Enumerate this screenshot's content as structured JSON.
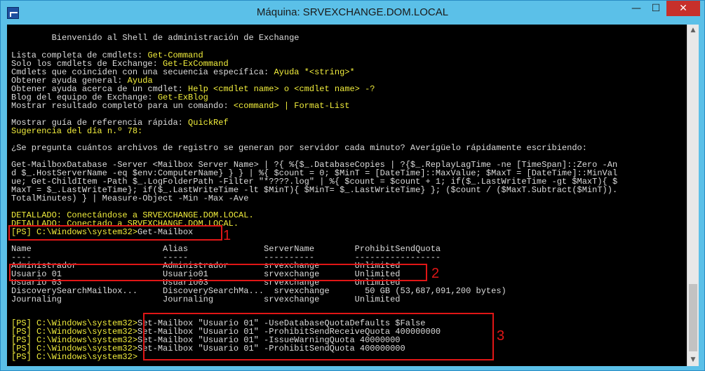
{
  "window": {
    "title": "Máquina: SRVEXCHANGE.DOM.LOCAL",
    "minimize": "—",
    "maximize": "☐",
    "close": "✕"
  },
  "console": {
    "welcome": "Bienvenido al Shell de administración de Exchange",
    "help_lines": [
      {
        "label": "Lista completa de cmdlets: ",
        "cmd": "Get-Command"
      },
      {
        "label": "Solo los cmdlets de Exchange: ",
        "cmd": "Get-ExCommand"
      },
      {
        "label": "Cmdlets que coinciden con una secuencia específica: ",
        "cmd": "Ayuda *<string>*"
      },
      {
        "label": "Obtener ayuda general: ",
        "cmd": "Ayuda"
      },
      {
        "label": "Obtener ayuda acerca de un cmdlet: ",
        "cmd": "Help <cmdlet name> o <cmdlet name> -?"
      },
      {
        "label": "Blog del equipo de Exchange: ",
        "cmd": "Get-ExBlog"
      },
      {
        "label": "Mostrar resultado completo para un comando: ",
        "cmd": "<command> | Format-List"
      }
    ],
    "quickref_label": "Mostrar guía de referencia rápida: ",
    "quickref_cmd": "QuickRef",
    "tip_title": "Sugerencia del día n.º 78:",
    "tip_question": "¿Se pregunta cuántos archivos de registro se generan por servidor cada minuto? Averígüelo rápidamente escribiendo:",
    "tip_code": [
      "Get-MailboxDatabase -Server <Mailbox Server Name> | ?{ %{$_.DatabaseCopies | ?{$_.ReplayLagTime -ne [TimeSpan]::Zero -An",
      "d $_.HostServerName -eq $env:ComputerName} } } | %{ $count = 0; $MinT = [DateTime]::MaxValue; $MaxT = [DateTime]::MinVal",
      "ue; Get-ChildItem -Path $_.LogFolderPath -Filter \"*????.log\" | %{ $count = $count + 1; if($_.LastWriteTime -gt $MaxT){ $",
      "MaxT = $_.LastWriteTime}; if($_.LastWriteTime -lt $MinT){ $MinT= $_.LastWriteTime} }; ($count / ($MaxT.Subtract($MinT)).",
      "TotalMinutes) } | Measure-Object -Min -Max -Ave"
    ],
    "detail_1": "DETALLADO: Conectándose a SRVEXCHANGE.DOM.LOCAL.",
    "detail_2": "DETALLADO: Conectado a SRVEXCHANGE.DOM.LOCAL.",
    "prompt": "[PS] C:\\Windows\\system32>",
    "command_1": "Get-Mailbox",
    "table_header": "Name                          Alias               ServerName        ProhibitSendQuota",
    "table_rule": "----                          -----               ----------        -----------------",
    "table_rows": [
      "Administrador                 Administrador       srvexchange       Unlimited",
      "Usuario 01                    Usuario01           srvexchange       Unlimited",
      "Usuario 03                    Usuario03           srvexchange       Unlimited",
      "DiscoverySearchMailbox...     DiscoverySearchMa...  srvexchange       50 GB (53,687,091,200 bytes)",
      "Journaling                    Journaling          srvexchange       Unlimited"
    ],
    "set_commands": [
      "Set-Mailbox \"Usuario 01\" -UseDatabaseQuotaDefaults $False",
      "Set-Mailbox \"Usuario 01\" -ProhibitSendReceiveQuota 400000000",
      "Set-Mailbox \"Usuario 01\" -IssueWarningQuota 40000000",
      "Set-Mailbox \"Usuario 01\" -ProhibitSendQuota 400000000"
    ]
  },
  "annotations": {
    "n1": "1",
    "n2": "2",
    "n3": "3"
  },
  "scrollbar": {
    "up": "▲",
    "down": "▼"
  }
}
